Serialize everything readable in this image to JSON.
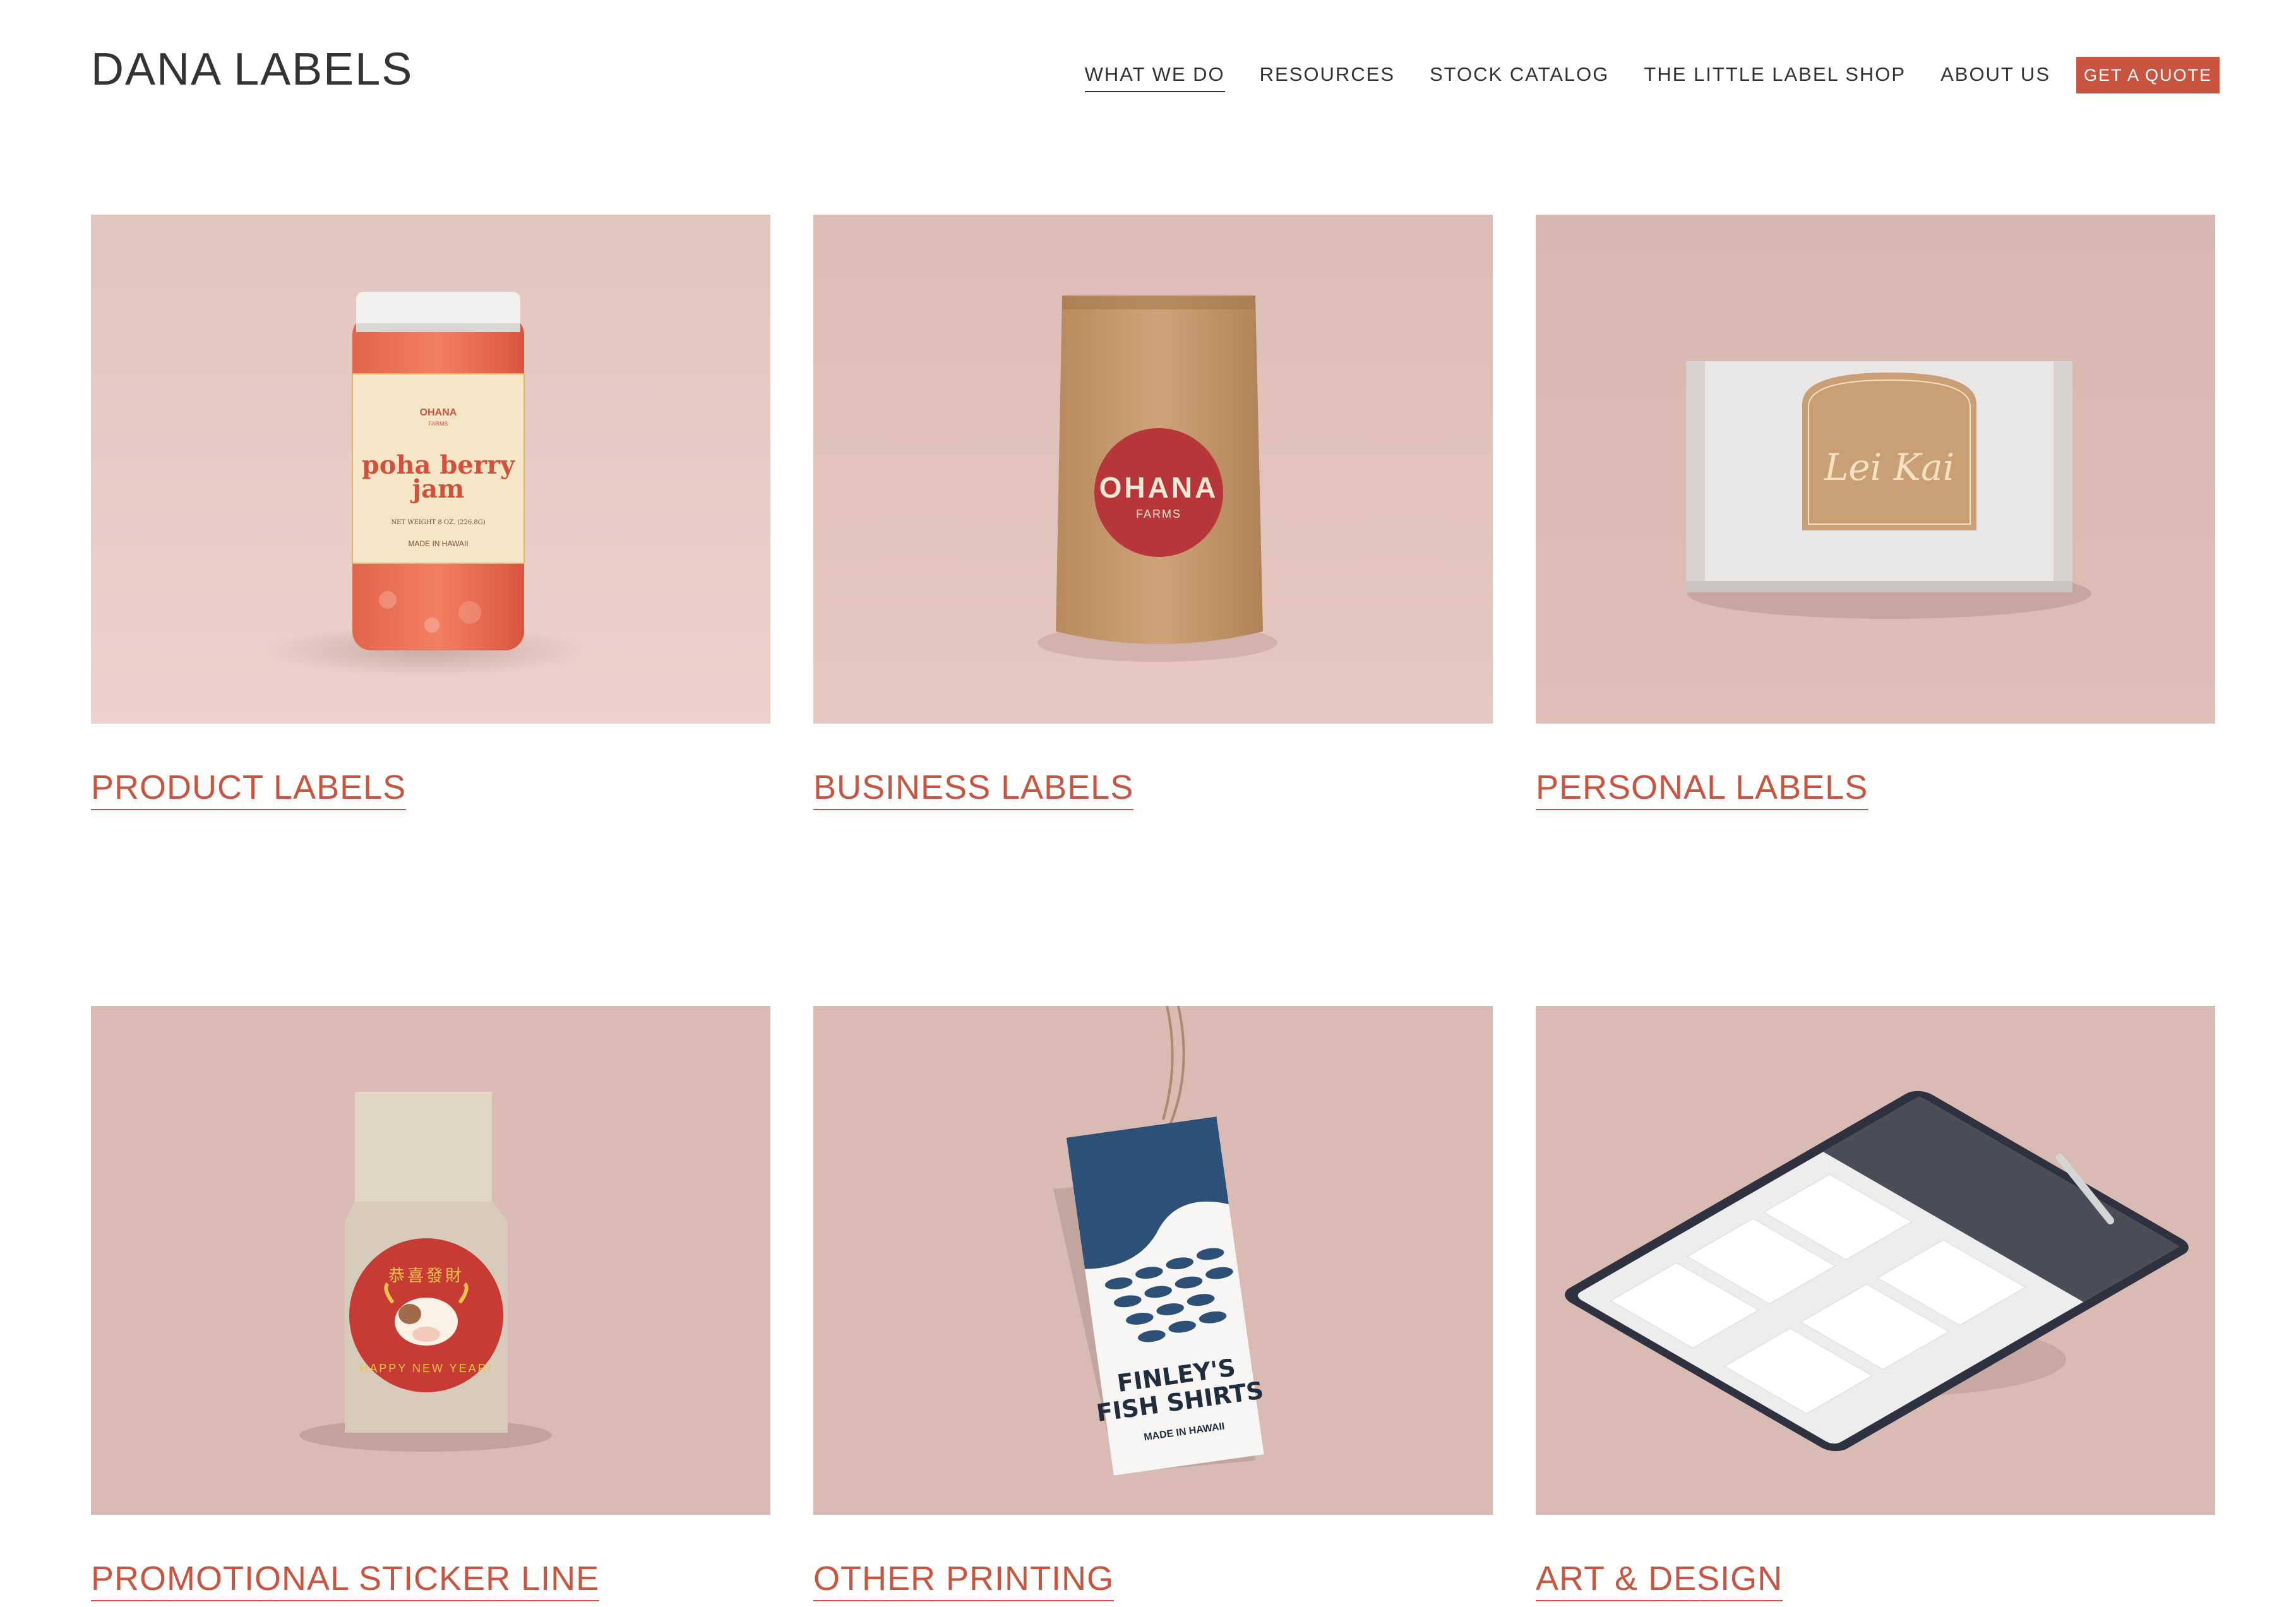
{
  "brand": {
    "name": "DANA LABELS"
  },
  "nav": {
    "items": [
      {
        "label": "WHAT WE DO",
        "active": true
      },
      {
        "label": "RESOURCES",
        "active": false
      },
      {
        "label": "STOCK CATALOG",
        "active": false
      },
      {
        "label": "THE LITTLE LABEL SHOP",
        "active": false
      },
      {
        "label": "ABOUT US",
        "active": false
      }
    ],
    "cta_label": "GET A QUOTE"
  },
  "colors": {
    "accent": "#c9543f",
    "text": "#333333",
    "tile_bg": "#dbbbb4",
    "tile_bg_light": "#e8c9c4"
  },
  "cards": [
    {
      "title": "PRODUCT LABELS",
      "image": {
        "subject": "jar-mockup",
        "label_brand": "OHANA",
        "label_sub": "FARMS",
        "label_line1": "poha berry",
        "label_line2": "jam",
        "label_weight": "NET WEIGHT 8 OZ. (226.8G)",
        "label_origin": "MADE IN HAWAII"
      }
    },
    {
      "title": "BUSINESS LABELS",
      "image": {
        "subject": "kraft-pouch-mockup",
        "label_brand": "OHANA",
        "label_sub": "FARMS"
      }
    },
    {
      "title": "PERSONAL LABELS",
      "image": {
        "subject": "gift-box-mockup",
        "label_script": "Lei Kai"
      }
    },
    {
      "title": "PROMOTIONAL STICKER LINE",
      "image": {
        "subject": "coffee-bag-mockup",
        "label_top": "恭喜發財",
        "label_bottom": "HAPPY NEW YEAR!"
      }
    },
    {
      "title": "OTHER PRINTING",
      "image": {
        "subject": "hang-tag-mockup",
        "label_line1": "FINLEY'S",
        "label_line2": "FISH SHIRTS",
        "label_origin": "MADE IN HAWAII"
      }
    },
    {
      "title": "ART & DESIGN",
      "image": {
        "subject": "tablet-mockup"
      }
    }
  ]
}
